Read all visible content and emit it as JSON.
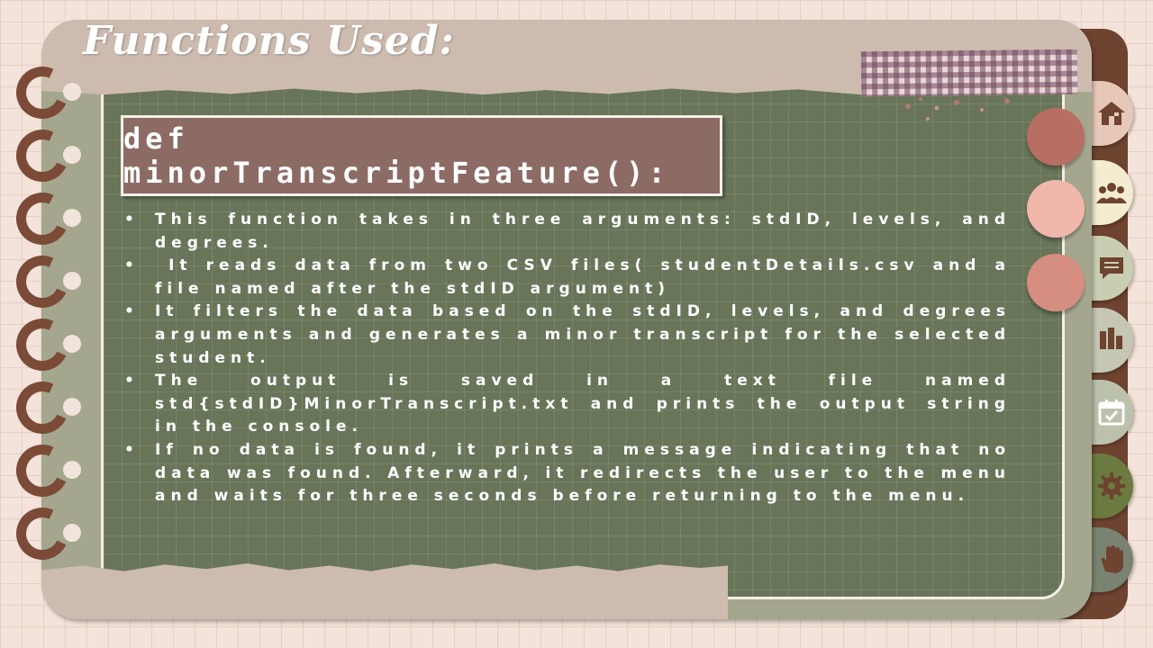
{
  "slide": {
    "title": "Functions Used:",
    "function_signature": "def minorTranscriptFeature():",
    "bullets": [
      "This function takes in three arguments: stdID, levels, and degrees.",
      " It reads data from two CSV files( studentDetails.csv and a file named after the stdID argument)",
      "It filters the data based on the stdID, levels, and degrees arguments and generates a minor transcript for the selected student.",
      "The output is saved in a text file named std{stdID}MinorTranscript.txt and prints the output string in the console.",
      "If no data is found, it prints a message indicating that no data was found. Afterward, it redirects the user to the menu and waits for three seconds before returning to the menu."
    ]
  },
  "tabs": [
    {
      "icon": "home-icon",
      "color": "#e7c8b8"
    },
    {
      "icon": "group-icon",
      "color": "#f4ecd0"
    },
    {
      "icon": "chat-icon",
      "color": "#c9ceb3"
    },
    {
      "icon": "bar-chart-icon",
      "color": "#c5c6b4"
    },
    {
      "icon": "calendar-check-icon",
      "color": "#bcc1ab"
    },
    {
      "icon": "gear-icon",
      "color": "#6b7a3f"
    },
    {
      "icon": "hand-icon",
      "color": "#7a8371"
    }
  ],
  "colors": {
    "background": "#f3e3da",
    "board": "#687559",
    "function_box": "#8c6b65",
    "spine": "#6e4330",
    "circle_1": "#b86e62",
    "circle_2": "#f1b7ab",
    "circle_3": "#d58e80"
  }
}
